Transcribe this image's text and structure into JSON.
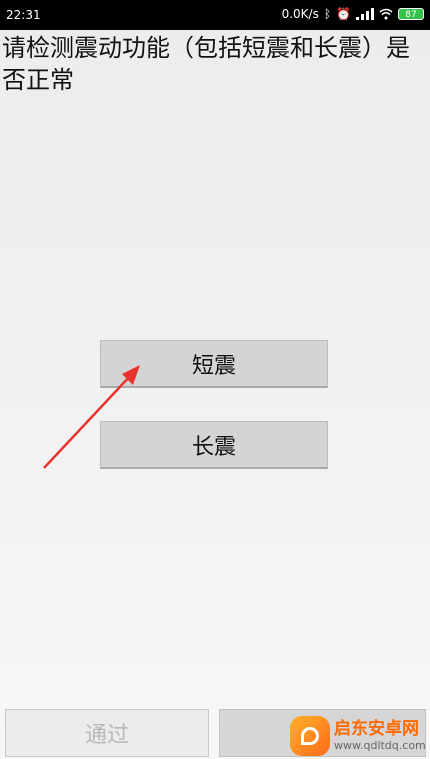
{
  "status_bar": {
    "time": "22:31",
    "net_speed": "0.0K/s",
    "battery": "87",
    "icons": [
      "bluetooth-icon",
      "alarm-mute-icon",
      "signal-icon",
      "wifi-icon",
      "battery-icon"
    ]
  },
  "prompt": {
    "text": "请检测震动功能（包括短震和长震）是否正常"
  },
  "buttons": {
    "short_vibrate": "短震",
    "long_vibrate": "长震",
    "pass": "通过"
  },
  "watermark": {
    "name": "启东安卓网",
    "url": "www.qdltdq.com"
  },
  "colors": {
    "arrow": "#e8342c",
    "watermark_accent": "#ff6a00"
  }
}
